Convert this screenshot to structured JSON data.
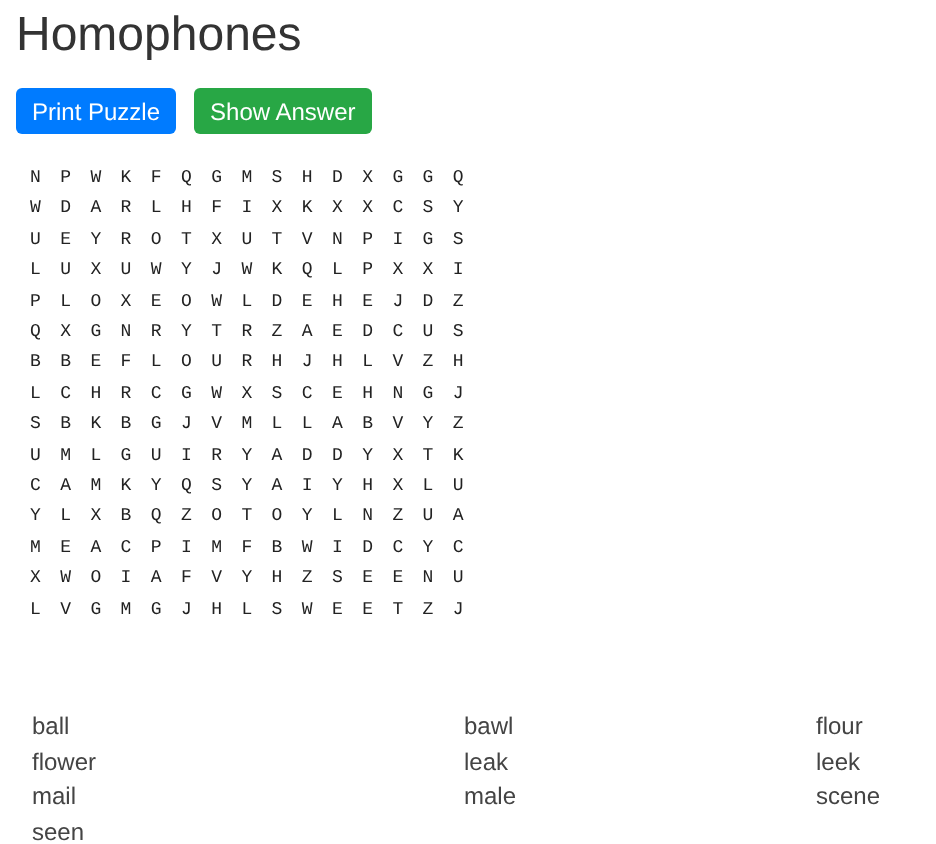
{
  "title": "Homophones",
  "buttons": [
    {
      "label": "Print Puzzle",
      "kind": "primary"
    },
    {
      "label": "Show Answer",
      "kind": "success"
    }
  ],
  "grid": [
    "NPWKFQGMSHDXGGQ",
    "WDARLHFIXKXXCSY",
    "UEYROTXUTVNPIGS",
    "LUXUWYJWKQLPXXI",
    "PLOXEOWLDEHEJDZ",
    "QXGNRYTRZAEDCUS",
    "BBEFLOURHJHLVZH",
    "LCHRCGWXSCEHNGJ",
    "SBKBGJVMLLABVYZ",
    "UMLGUIRYADDYXTK",
    "CAMKYQSYAIYHXLU",
    "YLXBQZOTOYLNZUA",
    "MEACPIMFBWIDCYC",
    "XWOIAFVYHZSEENU",
    "LVGMGJHLSWEETZJ"
  ],
  "words": [
    "ball",
    "bawl",
    "flour",
    "flower",
    "leak",
    "leek",
    "mail",
    "male",
    "scene",
    "seen"
  ]
}
